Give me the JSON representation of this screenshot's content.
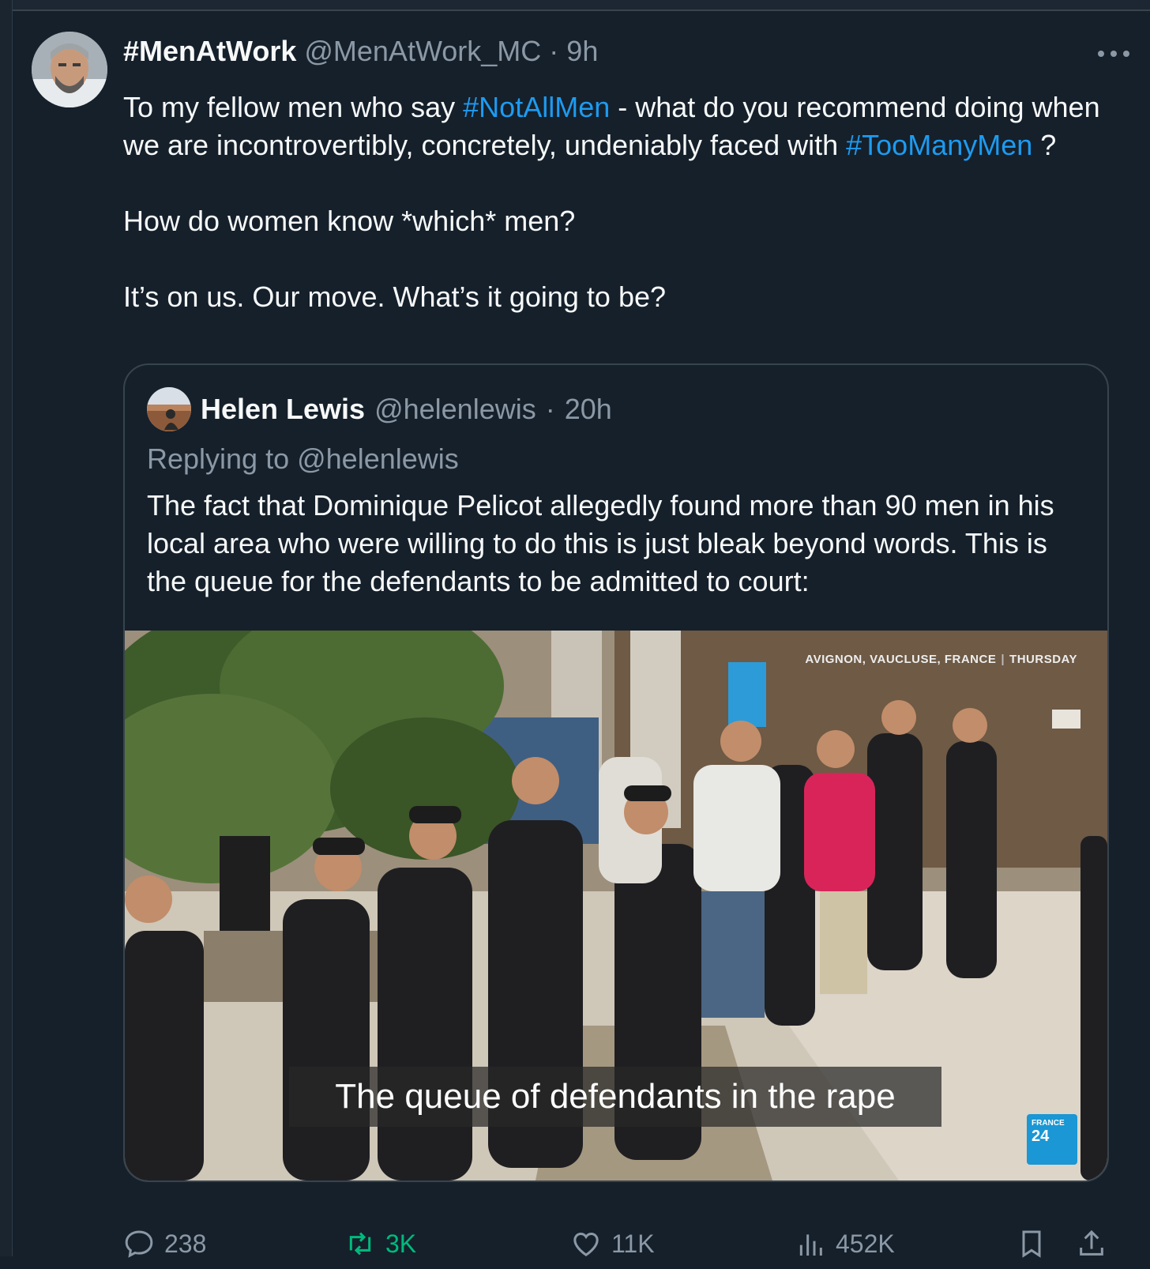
{
  "tweet": {
    "display_name": "#MenAtWork",
    "handle": "@MenAtWork_MC",
    "separator": "·",
    "time": "9h",
    "body": {
      "p1_a": "To my fellow men who say ",
      "p1_tag1": "#NotAllMen",
      "p1_b": " - what do you recommend doing when we are incontrovertibly, concretely, undeniably faced with ",
      "p1_tag2": "#TooManyMen",
      "p1_c": " ?",
      "p2": "How do women know *which* men?",
      "p3": "It’s on us. Our move. What’s it going to be?"
    }
  },
  "quote": {
    "display_name": "Helen Lewis",
    "handle": "@helenlewis",
    "separator": "·",
    "time": "20h",
    "replying_to": "Replying to @helenlewis",
    "text": "The fact that Dominique Pelicot allegedly found more than 90 men in his local area who were willing to do this is just bleak beyond words. This is the queue for the defendants to be admitted to court:",
    "media": {
      "caption": "The queue of defendants in the rape",
      "dateline_place": "AVIGNON, VAUCLUSE, FRANCE",
      "dateline_day": "THURSDAY",
      "logo_line1": "FRANCE",
      "logo_line2": "24"
    }
  },
  "actions": {
    "replies": "238",
    "retweets": "3K",
    "likes": "11K",
    "views": "452K"
  },
  "icons": {
    "more": "more-icon",
    "reply": "reply-icon",
    "retweet": "retweet-icon",
    "like": "like-icon",
    "views": "views-icon",
    "bookmark": "bookmark-icon",
    "share": "share-icon"
  },
  "colors": {
    "background": "#15202b",
    "text": "#f7f9f9",
    "muted": "#8b98a5",
    "link": "#1d9bf0",
    "retweet": "#00ba7c",
    "border": "#38444d"
  }
}
